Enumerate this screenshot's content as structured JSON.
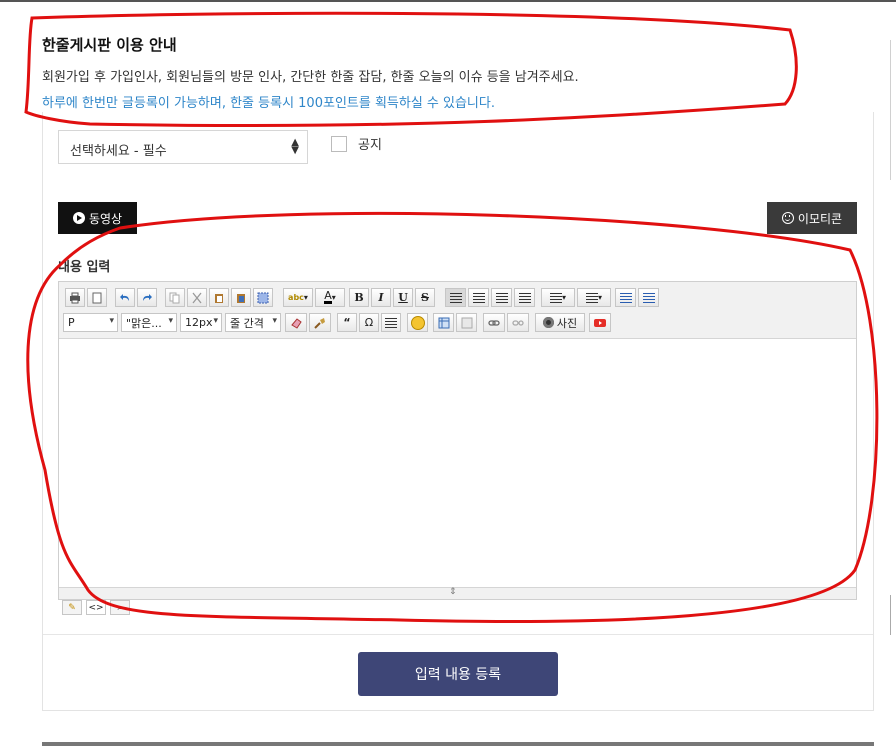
{
  "notice": {
    "title": "한줄게시판 이용 안내",
    "line1": "회원가입 후 가입인사, 회원님들의 방문 인사, 간단한 한줄 잡담, 한줄 오늘의 이슈 등을 남겨주세요.",
    "line2": "하루에 한번만 글등록이 가능하며, 한줄 등록시 100포인트를 획득하실 수 있습니다."
  },
  "form": {
    "category_select": "선택하세요 - 필수",
    "notice_checkbox_label": "공지",
    "notice_checked": false,
    "video_button": "동영상",
    "emoticon_button": "이모티콘",
    "content_label": "내용 입력",
    "submit_button": "입력 내용 등록"
  },
  "editor": {
    "format_select": "P",
    "font_select": "\"맑은...",
    "size_select": "12px",
    "line_spacing_select": "줄 간격",
    "photo_button": "사진",
    "bold": "B",
    "italic": "I",
    "underline": "U",
    "strike": "S",
    "quote": "“",
    "omega": "Ω",
    "mode_design_icon": "pencil-icon",
    "mode_html_icon": "code-icon",
    "mode_preview_icon": "magnifier-icon"
  },
  "colors": {
    "accent_link": "#2f86c9",
    "submit_bg": "#3e4677",
    "annotation": "#e01010"
  }
}
